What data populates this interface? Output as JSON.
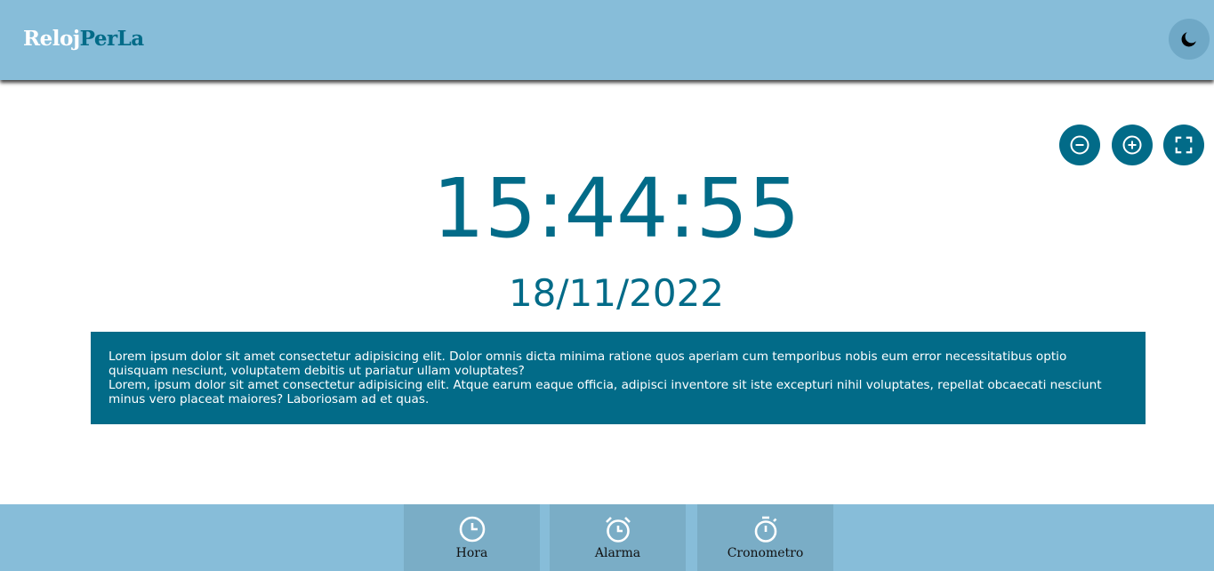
{
  "header": {
    "logo_part1": "Reloj",
    "logo_part2": "PerLa",
    "theme_toggle_icon": "moon-icon"
  },
  "controls": [
    {
      "icon": "zoom-out-icon"
    },
    {
      "icon": "zoom-in-icon"
    },
    {
      "icon": "fullscreen-icon"
    }
  ],
  "clock": {
    "time": "15:44:55",
    "date": "18/11/2022"
  },
  "description": {
    "line1": "Lorem ipsum dolor sit amet consectetur adipisicing elit. Dolor omnis dicta minima ratione quos aperiam cum temporibus nobis eum error necessitatibus optio quisquam nesciunt, voluptatem debitis ut pariatur ullam voluptates?",
    "line2": "Lorem, ipsum dolor sit amet consectetur adipisicing elit. Atque earum eaque officia, adipisci inventore sit iste excepturi nihil voluptates, repellat obcaecati nesciunt minus vero placeat maiores? Laboriosam ad et quas."
  },
  "footer": {
    "tabs": [
      {
        "label": "Hora",
        "icon": "clock-icon"
      },
      {
        "label": "Alarma",
        "icon": "alarm-clock-icon"
      },
      {
        "label": "Cronometro",
        "icon": "stopwatch-icon"
      }
    ]
  },
  "colors": {
    "primary": "#026b88",
    "header_bg": "#87bdd9",
    "tab_bg": "#7aadc6",
    "white": "#ffffff"
  }
}
